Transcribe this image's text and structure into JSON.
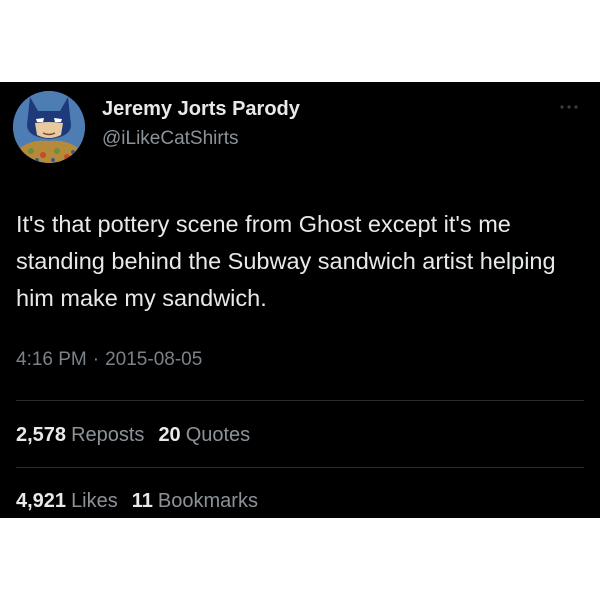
{
  "tweet": {
    "author": {
      "display_name": "Jeremy Jorts Parody",
      "handle": "@iLikeCatShirts",
      "avatar_icon": "batman-cartoon-avatar"
    },
    "text": "It's that pottery scene from Ghost except it's me standing behind the Subway sandwich artist helping him make my sandwich.",
    "time": "4:16 PM",
    "separator": "·",
    "date": "2015-08-05",
    "stats": {
      "reposts": {
        "value": "2,578",
        "label": "Reposts"
      },
      "quotes": {
        "value": "20",
        "label": "Quotes"
      },
      "likes": {
        "value": "4,921",
        "label": "Likes"
      },
      "bookmarks": {
        "value": "11",
        "label": "Bookmarks"
      }
    },
    "more_icon": "more-dots-icon"
  },
  "colors": {
    "card_background": "#000000",
    "primary_text": "#e7e9ea",
    "secondary_text": "#8b9399",
    "divider": "#2a2d30",
    "page_background": "#ffffff"
  }
}
